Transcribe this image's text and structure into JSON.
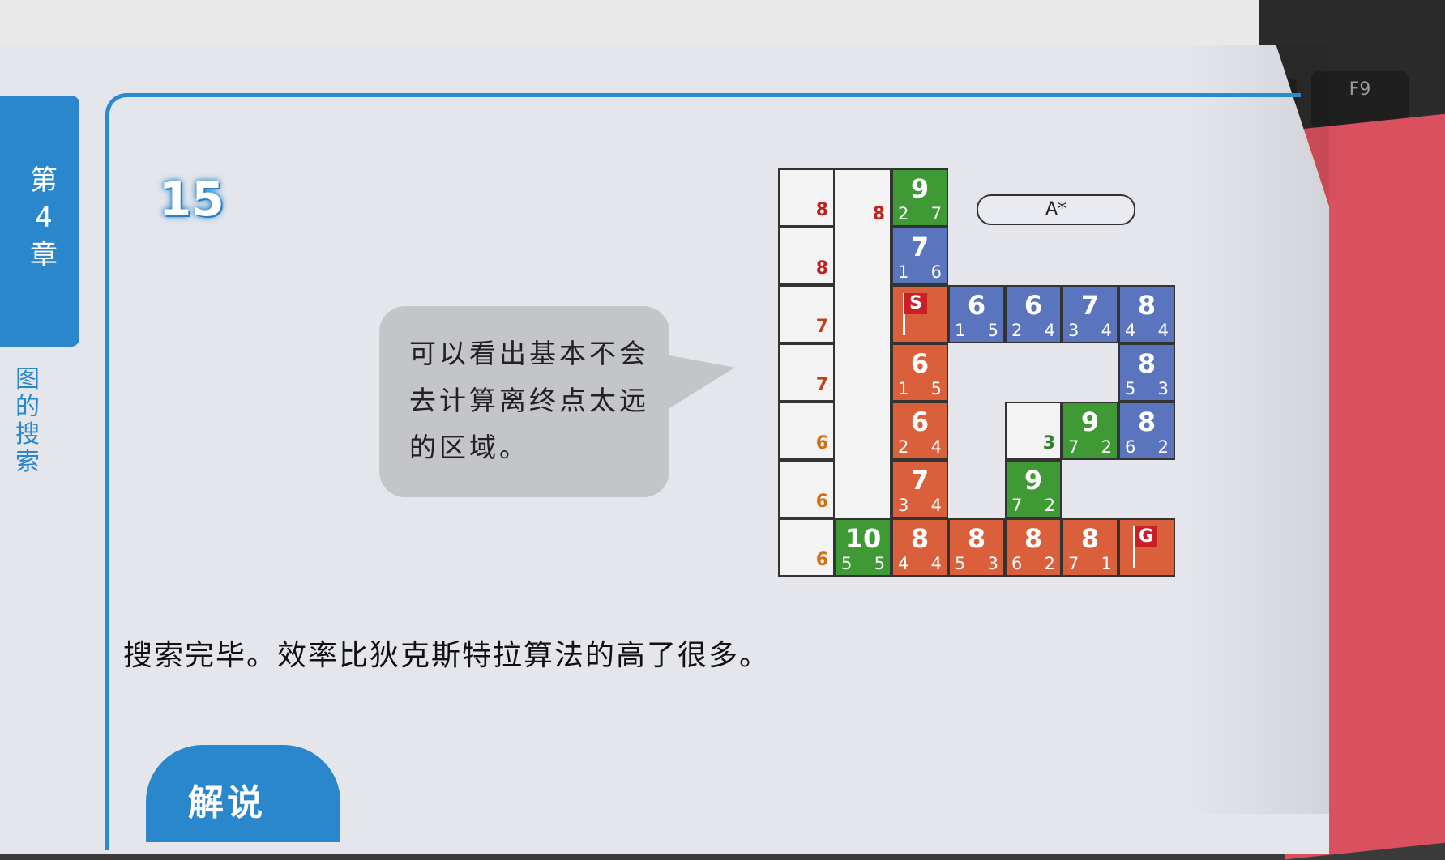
{
  "chapter_tab": {
    "text": "第4章"
  },
  "side_title": "图的搜索",
  "problem_number": "15",
  "speech_bubble": "可以看出基本不会去计算离终点太远的区域。",
  "algorithm_label": "A*",
  "caption": "搜索完毕。效率比狄克斯特拉算法的高了很多。",
  "section_label": "解说",
  "keyboard_key": "F9",
  "heuristic_column": [
    "8",
    "8",
    "7",
    "7",
    "6",
    "6",
    "6"
  ],
  "heuristic_colors": [
    "#c02020",
    "#c02020",
    "#c0401a",
    "#c0401a",
    "#d07010",
    "#d07010",
    "#d07010"
  ],
  "row0_extra": "8",
  "row4_extra": "3",
  "start_label": "S",
  "goal_label": "G",
  "tiles": [
    {
      "id": "t-r0c2",
      "big": "9",
      "l": "2",
      "r": "7",
      "color": "green"
    },
    {
      "id": "t-r1c2",
      "big": "7",
      "l": "1",
      "r": "6",
      "color": "blue"
    },
    {
      "id": "t-r2c3",
      "big": "6",
      "l": "1",
      "r": "5",
      "color": "blue"
    },
    {
      "id": "t-r2c4",
      "big": "6",
      "l": "2",
      "r": "4",
      "color": "blue"
    },
    {
      "id": "t-r2c5",
      "big": "7",
      "l": "3",
      "r": "4",
      "color": "blue"
    },
    {
      "id": "t-r2c6",
      "big": "8",
      "l": "4",
      "r": "4",
      "color": "blue"
    },
    {
      "id": "t-r3c2",
      "big": "6",
      "l": "1",
      "r": "5",
      "color": "orange"
    },
    {
      "id": "t-r3c6",
      "big": "8",
      "l": "5",
      "r": "3",
      "color": "blue"
    },
    {
      "id": "t-r4c2",
      "big": "6",
      "l": "2",
      "r": "4",
      "color": "orange"
    },
    {
      "id": "t-r4c5",
      "big": "9",
      "l": "7",
      "r": "2",
      "color": "green"
    },
    {
      "id": "t-r4c6",
      "big": "8",
      "l": "6",
      "r": "2",
      "color": "blue"
    },
    {
      "id": "t-r5c2",
      "big": "7",
      "l": "3",
      "r": "4",
      "color": "orange"
    },
    {
      "id": "t-r5c4",
      "big": "9",
      "l": "7",
      "r": "2",
      "color": "green"
    },
    {
      "id": "t-r6c1",
      "big": "10",
      "l": "5",
      "r": "5",
      "color": "green"
    },
    {
      "id": "t-r6c2",
      "big": "8",
      "l": "4",
      "r": "4",
      "color": "orange"
    },
    {
      "id": "t-r6c3",
      "big": "8",
      "l": "5",
      "r": "3",
      "color": "orange"
    },
    {
      "id": "t-r6c4",
      "big": "8",
      "l": "6",
      "r": "2",
      "color": "orange"
    },
    {
      "id": "t-r6c5",
      "big": "8",
      "l": "7",
      "r": "1",
      "color": "orange"
    }
  ]
}
